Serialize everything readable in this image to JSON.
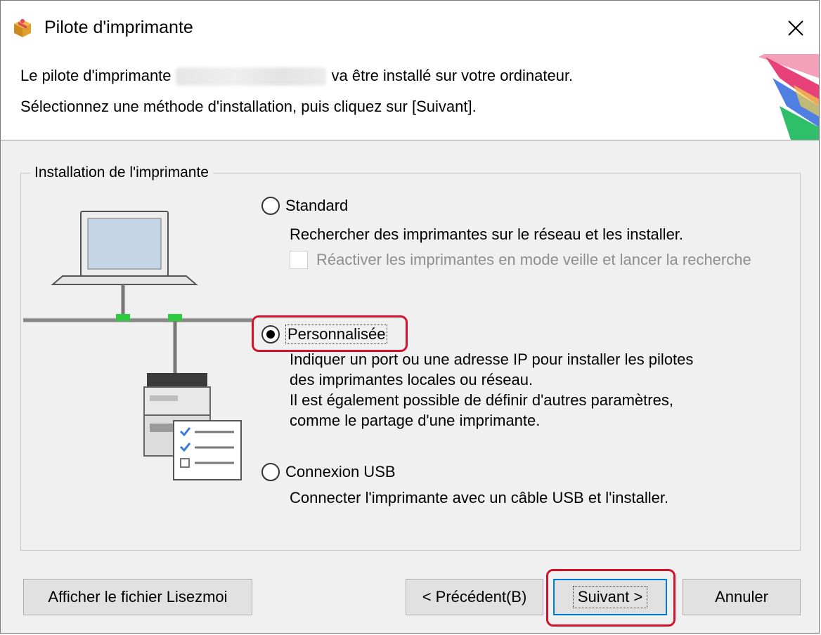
{
  "window": {
    "title": "Pilote d'imprimante"
  },
  "header": {
    "line1_before": "Le pilote d'imprimante",
    "line1_after": "va être installé sur votre ordinateur.",
    "line2": "Sélectionnez une méthode d'installation, puis cliquez sur [Suivant]."
  },
  "group": {
    "label": "Installation de l'imprimante"
  },
  "options": {
    "standard": {
      "label": "Standard",
      "selected": false,
      "desc": "Rechercher des imprimantes sur le réseau et les installer.",
      "checkbox_label": "Réactiver les imprimantes en mode veille et lancer la recherche"
    },
    "custom": {
      "label": "Personnalisée",
      "selected": true,
      "desc1": "Indiquer un port ou une adresse IP pour installer les pilotes",
      "desc2": "des imprimantes locales ou réseau.",
      "desc3": "Il est également possible de définir d'autres paramètres,",
      "desc4": "comme le partage d'une imprimante."
    },
    "usb": {
      "label": "Connexion USB",
      "selected": false,
      "desc": "Connecter l'imprimante avec un câble USB et l'installer."
    }
  },
  "buttons": {
    "readme": "Afficher le fichier Lisezmoi",
    "previous": "< Précédent(B)",
    "next": "Suivant >",
    "cancel": "Annuler"
  },
  "colors": {
    "highlight": "#d3132c",
    "focus_border": "#0078d7",
    "network_connector": "#2ecc40"
  },
  "icons": {
    "app": "package-icon",
    "close": "close-icon",
    "illustration": "network-computer-printer-illustration"
  }
}
